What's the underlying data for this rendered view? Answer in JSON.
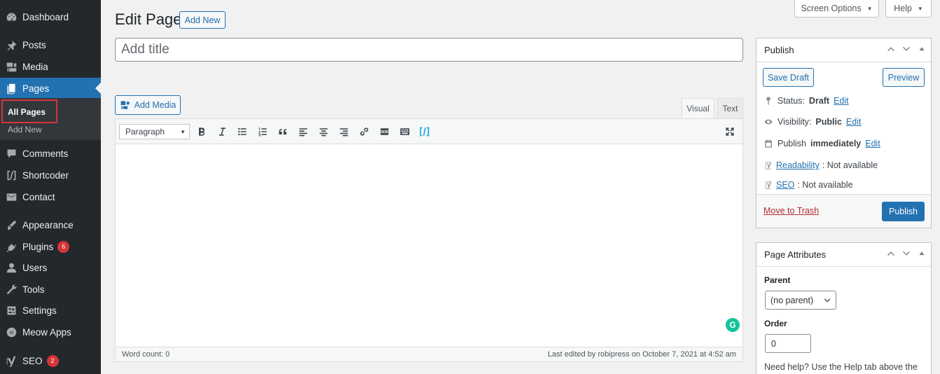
{
  "sidebar": {
    "items": [
      {
        "label": "Dashboard",
        "icon": "dashboard-icon"
      },
      {
        "label": "Posts",
        "icon": "pin-icon"
      },
      {
        "label": "Media",
        "icon": "media-icon"
      },
      {
        "label": "Pages",
        "icon": "pages-icon"
      },
      {
        "label": "Comments",
        "icon": "comment-icon"
      },
      {
        "label": "Shortcoder",
        "icon": "shortcode-icon"
      },
      {
        "label": "Contact",
        "icon": "mail-icon"
      },
      {
        "label": "Appearance",
        "icon": "brush-icon"
      },
      {
        "label": "Plugins",
        "icon": "plugin-icon",
        "badge": "6"
      },
      {
        "label": "Users",
        "icon": "user-icon"
      },
      {
        "label": "Tools",
        "icon": "wrench-icon"
      },
      {
        "label": "Settings",
        "icon": "settings-icon"
      },
      {
        "label": "Meow Apps",
        "icon": "meow-icon"
      },
      {
        "label": "SEO",
        "icon": "yoast-icon",
        "badge": "2"
      }
    ],
    "submenu": {
      "all_pages": "All Pages",
      "add_new": "Add New"
    }
  },
  "top_buttons": {
    "screen_options": "Screen Options",
    "help": "Help"
  },
  "heading": {
    "title": "Edit Page",
    "add_new": "Add New"
  },
  "title_field": {
    "placeholder": "Add title",
    "value": ""
  },
  "editor": {
    "add_media": "Add Media",
    "tab_visual": "Visual",
    "tab_text": "Text",
    "format": "Paragraph",
    "grammarly": "G",
    "word_count": "Word count: 0",
    "last_edited": "Last edited by robipress on October 7, 2021 at 4:52 am"
  },
  "publish": {
    "title": "Publish",
    "save_draft": "Save Draft",
    "preview": "Preview",
    "status_label": "Status:",
    "status_value": "Draft",
    "visibility_label": "Visibility:",
    "visibility_value": "Public",
    "publish_label": "Publish",
    "publish_value": "immediately",
    "edit": "Edit",
    "readability_link": "Readability",
    "readability_value": ": Not available",
    "seo_link": "SEO",
    "seo_value": ": Not available",
    "trash": "Move to Trash",
    "publish_button": "Publish"
  },
  "page_attributes": {
    "title": "Page Attributes",
    "parent_label": "Parent",
    "parent_value": "(no parent)",
    "order_label": "Order",
    "order_value": "0",
    "help": "Need help? Use the Help tab above the"
  },
  "colors": {
    "accent": "#2271b1",
    "sidebar": "#23282d",
    "badge": "#d63638"
  }
}
